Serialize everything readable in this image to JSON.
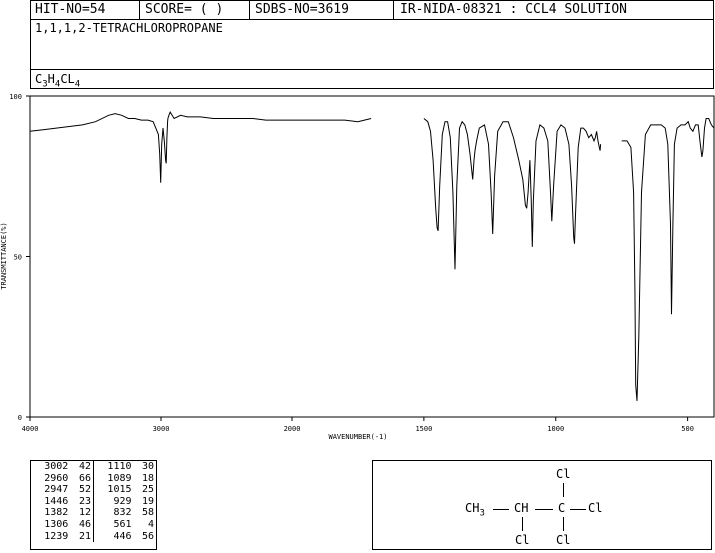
{
  "header": {
    "hit_no": "HIT-NO=54",
    "score": "SCORE=  (   )",
    "sdbs_no": "SDBS-NO=3619",
    "ir_code": "IR-NIDA-08321 : CCL4 SOLUTION"
  },
  "compound": {
    "name": "1,1,1,2-TETRACHLOROPROPANE",
    "formula_parts": [
      "C",
      "3",
      "H",
      "4",
      "CL",
      "4"
    ]
  },
  "chart_data": {
    "type": "line",
    "xlabel": "WAVENUMBER(-1)",
    "ylabel": "TRANSMITTANCE(%)",
    "xlim": [
      4000,
      400
    ],
    "ylim": [
      0,
      100
    ],
    "x_ticks": [
      "4000",
      "3000",
      "2000",
      "1500",
      "1000",
      "500"
    ],
    "y_ticks": [
      "100",
      "50",
      "0"
    ],
    "grid": false,
    "series": [
      {
        "x": [
          4000,
          3900,
          3800,
          3700,
          3600,
          3500,
          3400,
          3350,
          3300,
          3250,
          3200,
          3150,
          3100,
          3060,
          3040,
          3020,
          3010,
          3002,
          2995,
          2985,
          2975,
          2965,
          2960,
          2955,
          2950,
          2947,
          2940,
          2930,
          2900,
          2850,
          2800,
          2700,
          2600,
          2500,
          2400,
          2300,
          2200,
          2100,
          2000,
          1900,
          1800,
          1750,
          1700
        ],
        "y": [
          89,
          89.5,
          90,
          90.5,
          91,
          92,
          94,
          94.5,
          94,
          93,
          93,
          92.5,
          92.5,
          92,
          90,
          88,
          82,
          73,
          85,
          90,
          86,
          80,
          79,
          87,
          92,
          93,
          94,
          95,
          93,
          94,
          93.5,
          93.5,
          93,
          93,
          93,
          93,
          92.5,
          92.5,
          92.5,
          92.5,
          92.5,
          92,
          93
        ]
      },
      {
        "x": [
          1500,
          1485,
          1475,
          1465,
          1455,
          1450,
          1446,
          1440,
          1430,
          1420,
          1410,
          1400,
          1390,
          1382,
          1375,
          1365,
          1355,
          1345,
          1335,
          1325,
          1315,
          1310,
          1306,
          1300,
          1290,
          1270,
          1255,
          1245,
          1239,
          1232,
          1220,
          1200,
          1180,
          1160,
          1140,
          1125,
          1115,
          1110,
          1105,
          1098,
          1093,
          1089,
          1085,
          1075,
          1060,
          1045,
          1030,
          1020,
          1015,
          1008,
          995,
          980,
          965,
          950,
          940,
          932,
          929,
          925,
          915,
          905,
          895,
          885,
          875,
          865,
          855,
          850,
          845,
          840,
          835,
          832,
          830
        ],
        "y": [
          93,
          92,
          89,
          80,
          65,
          59,
          58,
          72,
          88,
          92,
          92,
          87,
          70,
          46,
          72,
          90,
          92,
          91,
          88,
          82,
          74,
          80,
          83,
          86,
          90,
          91,
          85,
          70,
          57,
          75,
          89,
          92,
          92,
          87,
          80,
          74,
          66,
          65,
          70,
          80,
          68,
          53,
          67,
          86,
          91,
          90,
          86,
          70,
          61,
          72,
          89,
          91,
          90,
          85,
          72,
          56,
          54,
          63,
          84,
          90,
          90,
          89,
          87,
          88,
          86,
          87,
          89,
          86,
          84,
          83,
          85
        ]
      },
      {
        "x": [
          750,
          730,
          715,
          705,
          700,
          697,
          692,
          685,
          675,
          660,
          640,
          620,
          600,
          585,
          575,
          565,
          561,
          556,
          550,
          540,
          525,
          510,
          498,
          490,
          480,
          470,
          460,
          452,
          446,
          442,
          436,
          430,
          420,
          410,
          400
        ],
        "y": [
          86,
          86,
          84,
          70,
          40,
          10,
          5,
          25,
          70,
          88,
          91,
          91,
          91,
          90,
          85,
          60,
          32,
          60,
          85,
          90,
          91,
          91,
          92,
          90,
          89,
          91,
          91,
          85,
          81,
          83,
          90,
          93,
          93,
          91,
          90
        ]
      }
    ]
  },
  "peak_table": {
    "rows": [
      [
        "3002",
        "42",
        "1110",
        "30"
      ],
      [
        "2960",
        "66",
        "1089",
        "18"
      ],
      [
        "2947",
        "52",
        "1015",
        "25"
      ],
      [
        "1446",
        "23",
        "929",
        "19"
      ],
      [
        "1382",
        "12",
        "832",
        "58"
      ],
      [
        "1306",
        "46",
        "561",
        "4"
      ],
      [
        "1239",
        "21",
        "446",
        "56"
      ]
    ]
  },
  "structure": {
    "ch3": "CH",
    "ch3_sub": "3",
    "ch": "CH",
    "c": "C",
    "cl_top": "Cl",
    "cl_right": "Cl",
    "cl_bottom_left": "Cl",
    "cl_bottom_right": "Cl"
  }
}
